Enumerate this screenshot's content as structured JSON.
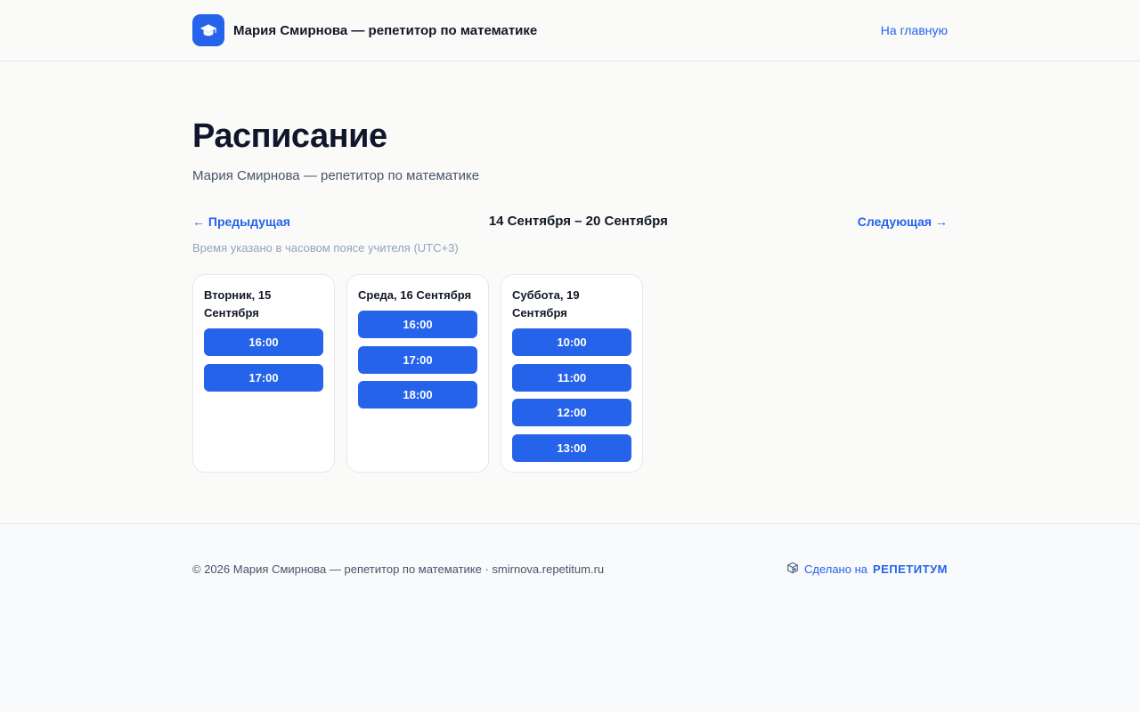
{
  "header": {
    "brand_name": "Мария Смирнова — репетитор по математике",
    "home_link": "На главную",
    "logo_icon": "graduation-cap-icon"
  },
  "page": {
    "title": "Расписание",
    "subtitle": "Мария Смирнова — репетитор по математике"
  },
  "week_nav": {
    "prev_label": "← Предыдущая",
    "range": "14 Сентября – 20 Сентября",
    "next_label": "Следующая →",
    "timezone_note": "Время указано в часовом поясе учителя (UTC+3)"
  },
  "days": [
    {
      "label": "Вторник, 15 Сентября",
      "slots": [
        "16:00",
        "17:00"
      ]
    },
    {
      "label": "Среда, 16 Сентября",
      "slots": [
        "16:00",
        "17:00",
        "18:00"
      ]
    },
    {
      "label": "Суббота, 19 Сентября",
      "slots": [
        "10:00",
        "11:00",
        "12:00",
        "13:00"
      ]
    }
  ],
  "footer": {
    "copyright": "© 2026 Мария Смирнова — репетитор по математике · smirnova.repetitum.ru",
    "made_on_prefix": "Сделано на",
    "made_on_brand": "РЕПЕТИТУМ",
    "made_on_icon": "cube-icon"
  },
  "colors": {
    "accent": "#2563eb",
    "background": "#fafaf9",
    "text": "#0f172a",
    "muted": "#94a3b8"
  }
}
